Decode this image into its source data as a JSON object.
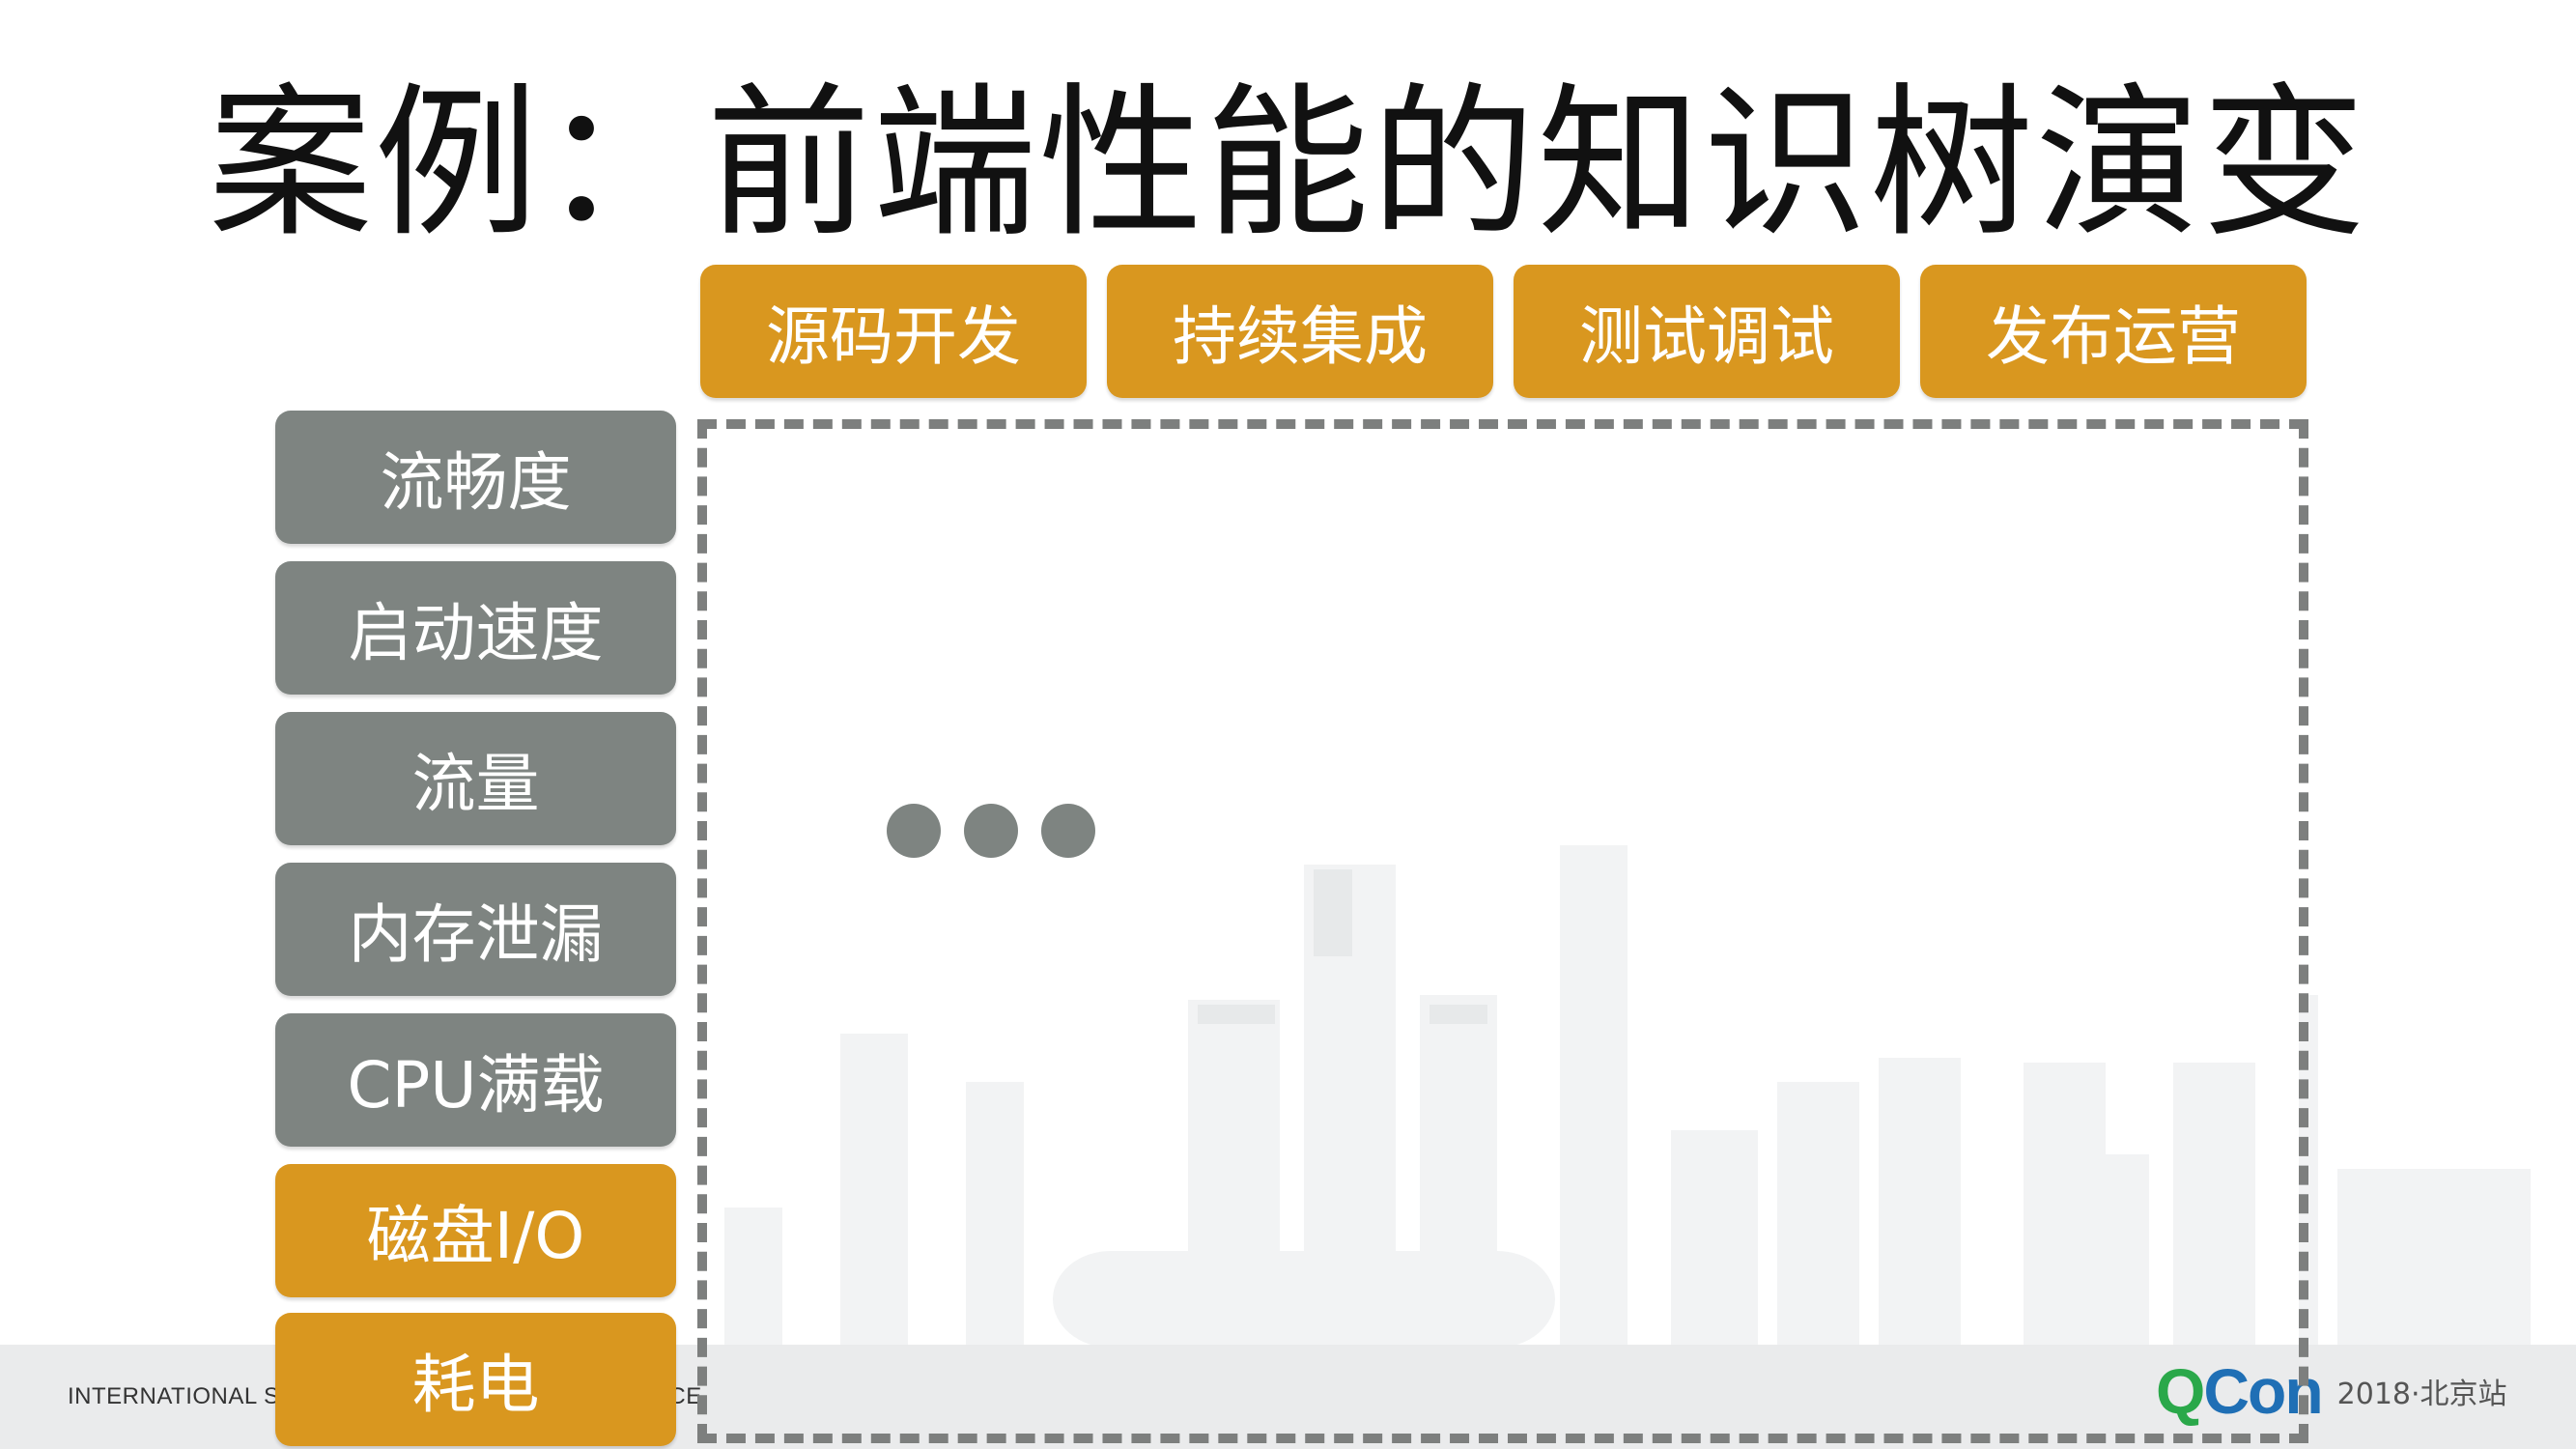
{
  "slide": {
    "title": "案例：前端性能的知识树演变"
  },
  "stages": [
    {
      "label": "源码开发"
    },
    {
      "label": "持续集成"
    },
    {
      "label": "测试调试"
    },
    {
      "label": "发布运营"
    }
  ],
  "metrics": [
    {
      "label": "流畅度",
      "color": "#7e8481"
    },
    {
      "label": "启动速度",
      "color": "#7e8481"
    },
    {
      "label": "流量",
      "color": "#7e8481"
    },
    {
      "label": "内存泄漏",
      "color": "#7e8481"
    },
    {
      "label": "CPU满载",
      "color": "#7e8481"
    },
    {
      "label": "磁盘I/O",
      "color": "#d9971f"
    },
    {
      "label": "耗电",
      "color": "#d9971f"
    }
  ],
  "ellipsis": "...",
  "footer": {
    "conference_text_left": "INTERNATIONAL SC",
    "conference_text_right": "CE",
    "logo_q": "Q",
    "logo_con": "Con",
    "edition": "2018·北京站"
  },
  "colors": {
    "accent_orange": "#d9971f",
    "gray_box": "#7e8481",
    "dashed_border": "#7d7f7e",
    "qcon_green": "#2aa84a",
    "qcon_blue": "#1f6fb5"
  }
}
